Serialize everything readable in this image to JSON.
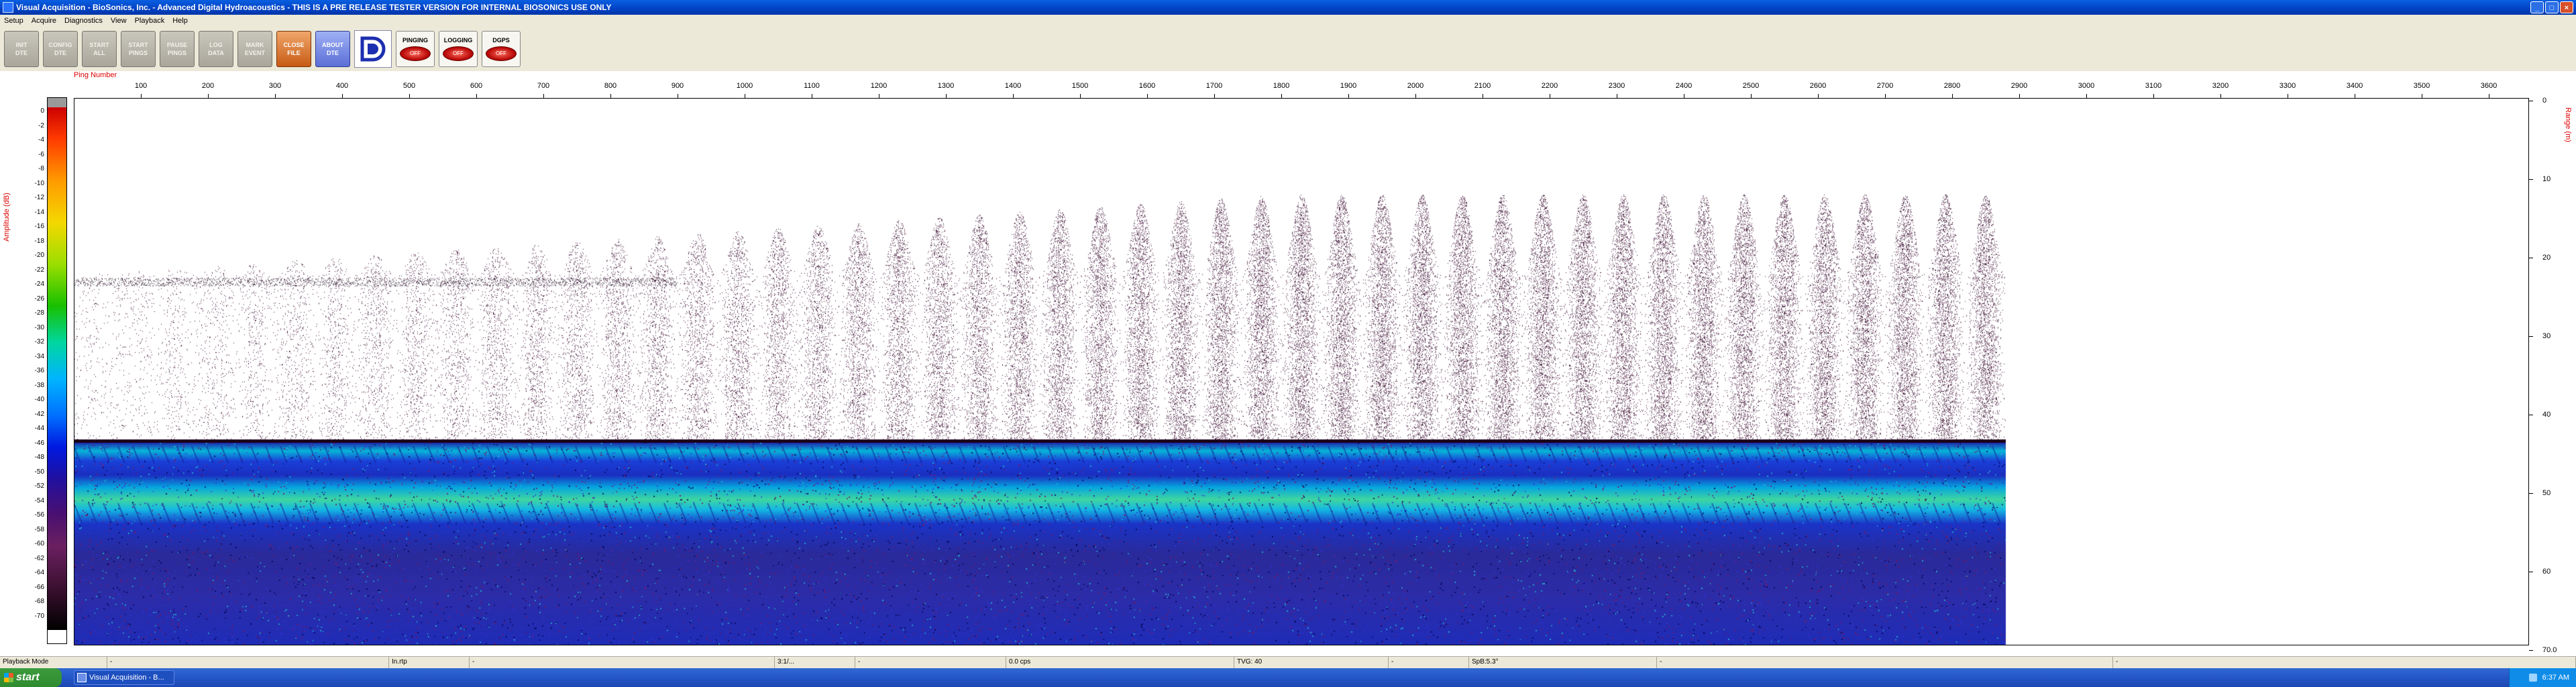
{
  "window": {
    "title": "Visual Acquisition  -  BioSonics, Inc.  -  Advanced Digital Hydroacoustics  -  THIS IS A PRE RELEASE TESTER VERSION FOR INTERNAL BIOSONICS USE ONLY",
    "app_icon": "app-icon",
    "buttons": {
      "minimize": "_",
      "maximize": "□",
      "close": "×"
    }
  },
  "menu": [
    "Setup",
    "Acquire",
    "Diagnostics",
    "View",
    "Playback",
    "Help"
  ],
  "toolbar": {
    "buttons": [
      {
        "id": "init-dte",
        "label": "INIT\nDTE"
      },
      {
        "id": "config-dte",
        "label": "CONFIG\nDTE"
      },
      {
        "id": "start-all",
        "label": "START\nALL"
      },
      {
        "id": "start-pings",
        "label": "START\nPINGS"
      },
      {
        "id": "pause-pings",
        "label": "PAUSE\nPINGS"
      },
      {
        "id": "log-data",
        "label": "LOG\nDATA"
      },
      {
        "id": "mark-event",
        "label": "MARK\nEVENT"
      },
      {
        "id": "close-file",
        "label": "CLOSE\nFILE"
      },
      {
        "id": "about-dte",
        "label": "ABOUT\nDTE"
      }
    ],
    "status": [
      {
        "id": "pinging",
        "label": "PINGING",
        "led": "OFF"
      },
      {
        "id": "logging",
        "label": "LOGGING",
        "led": "OFF"
      },
      {
        "id": "dgps",
        "label": "DGPS",
        "led": "OFF"
      }
    ]
  },
  "plot": {
    "ping_axis_label": "Ping Number",
    "amplitude_label": "Amplitude (dB)",
    "range_label": "Range (m)",
    "ping_ticks": [
      "100",
      "200",
      "300",
      "400",
      "500",
      "600",
      "700",
      "800",
      "900",
      "1000",
      "1100",
      "1200",
      "1300",
      "1400",
      "1500",
      "1600",
      "1700",
      "1800",
      "1900",
      "2000",
      "2100",
      "2200",
      "2300",
      "2400",
      "2500",
      "2600",
      "2700",
      "2800",
      "2900",
      "3000",
      "3100",
      "3200",
      "3300",
      "3400",
      "3500",
      "3600"
    ],
    "amplitude_ticks": [
      "0",
      "-2",
      "-4",
      "-6",
      "-8",
      "-10",
      "-12",
      "-14",
      "-16",
      "-18",
      "-20",
      "-22",
      "-24",
      "-26",
      "-28",
      "-30",
      "-32",
      "-34",
      "-36",
      "-38",
      "-40",
      "-42",
      "-44",
      "-46",
      "-48",
      "-50",
      "-52",
      "-54",
      "-56",
      "-58",
      "-60",
      "-62",
      "-64",
      "-66",
      "-68",
      "-70"
    ],
    "range_ticks": [
      "0",
      "10",
      "20",
      "30",
      "40",
      "50",
      "60",
      "70.0"
    ],
    "colors": {
      "axis_label": "#dd0000",
      "surface_noise": "#4a1040",
      "bottom_band": "#10c0d0"
    }
  },
  "statusbar": {
    "mode": "Playback Mode",
    "c1": "-",
    "c2": "In.rtp",
    "c3": "-",
    "c4": "3:1/...",
    "c5": "-",
    "c6": "0.0 cps",
    "c7": "TVG: 40",
    "c8": "-",
    "c9": "SpB:5.3°",
    "c10": "-",
    "c11": "-"
  },
  "taskbar": {
    "start": "start",
    "task": "Visual Acquisition - B...",
    "clock": "6:37 AM"
  }
}
